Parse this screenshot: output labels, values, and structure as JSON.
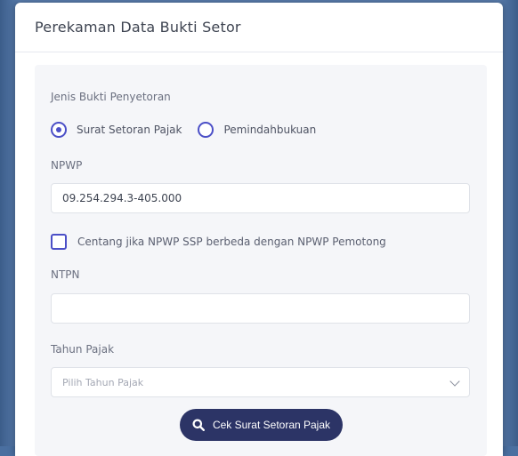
{
  "modal": {
    "title": "Perekaman Data Bukti Setor"
  },
  "form": {
    "jenis_label": "Jenis Bukti Penyetoran",
    "radio_options": [
      {
        "label": "Surat Setoran Pajak",
        "selected": true
      },
      {
        "label": "Pemindahbukuan",
        "selected": false
      }
    ],
    "npwp_label": "NPWP",
    "npwp_value": "09.254.294.3-405.000",
    "checkbox_label": "Centang jika NPWP SSP berbeda dengan NPWP Pemotong",
    "checkbox_checked": false,
    "ntpn_label": "NTPN",
    "ntpn_value": "",
    "tahun_label": "Tahun Pajak",
    "tahun_placeholder": "Pilih Tahun Pajak",
    "submit_label": "Cek Surat Setoran Pajak"
  },
  "colors": {
    "accent": "#4b4fc7",
    "button": "#2c3466"
  },
  "icons": {
    "submit": "search-icon",
    "select": "chevron-down-icon"
  }
}
